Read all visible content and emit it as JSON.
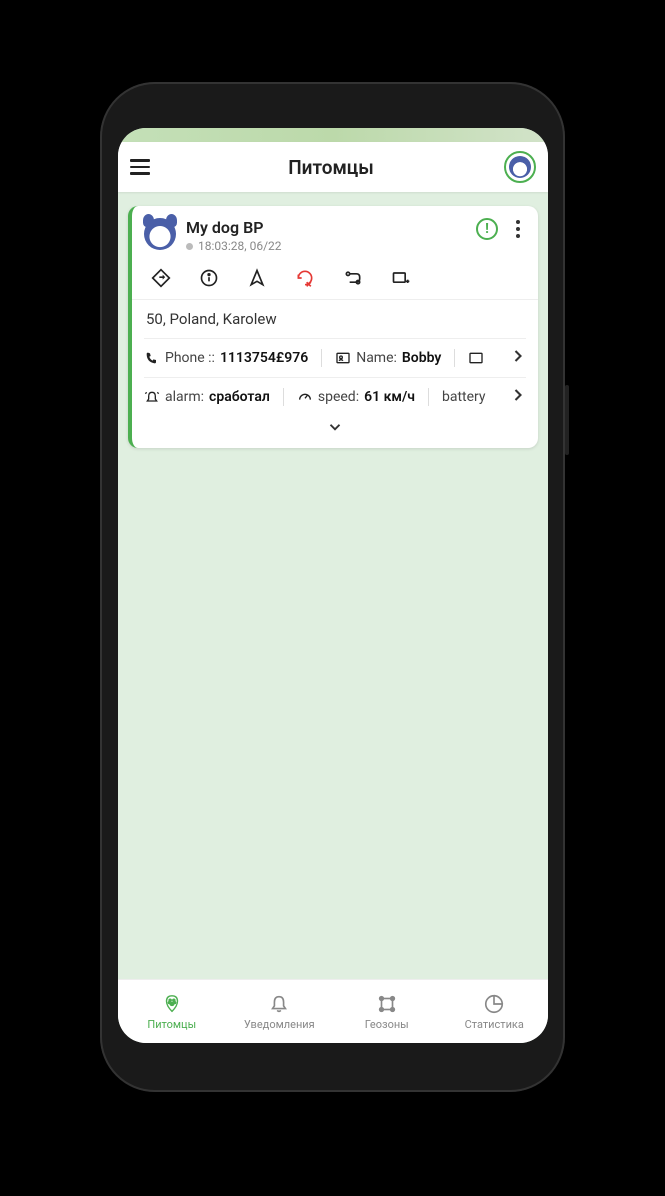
{
  "header": {
    "title": "Питомцы"
  },
  "card": {
    "pet_name": "My dog BP",
    "timestamp": "18:03:28, 06/22",
    "address": "50, Poland, Karolew",
    "phone_label": "Phone ::",
    "phone_value": "1113754£976",
    "name_label": "Name:",
    "name_value": "Bobby",
    "alarm_label": "alarm:",
    "alarm_value": "сработал",
    "speed_label": "speed:",
    "speed_value": "61 км/ч",
    "battery_label": "battery"
  },
  "nav": {
    "items": [
      {
        "label": "Питомцы"
      },
      {
        "label": "Уведомления"
      },
      {
        "label": "Геозоны"
      },
      {
        "label": "Статистика"
      }
    ]
  },
  "colors": {
    "accent": "#4caf50",
    "danger": "#e53935"
  }
}
